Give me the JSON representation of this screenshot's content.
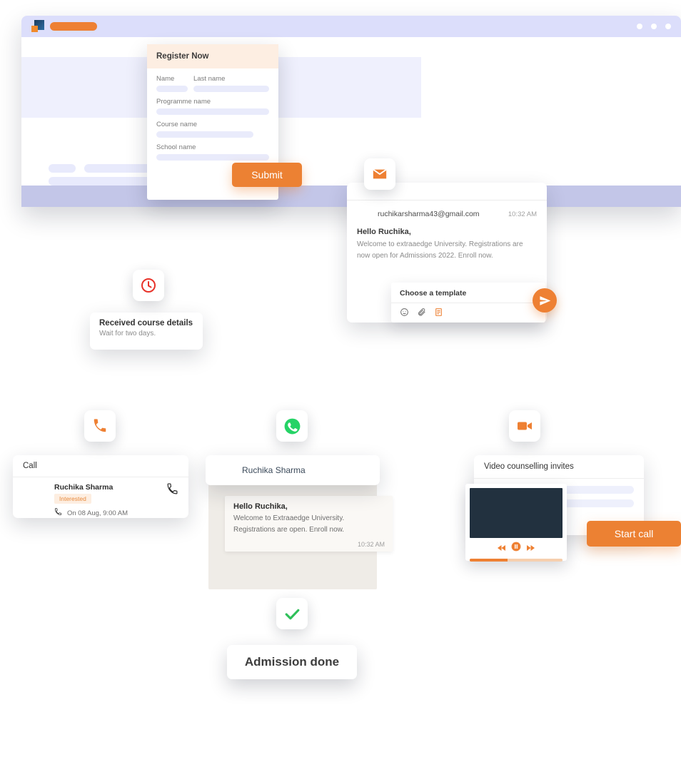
{
  "browser": {
    "logo_icon": "brand-logo-icon",
    "dots": [
      "dot",
      "dot",
      "dot"
    ]
  },
  "register_form": {
    "title": "Register Now",
    "fields": [
      {
        "label": "Name"
      },
      {
        "label": "Last name"
      },
      {
        "label": "Programme name"
      },
      {
        "label": "Course name"
      },
      {
        "label": "School name"
      }
    ],
    "submit_label": "Submit"
  },
  "email_card": {
    "node_icon": "envelope-icon",
    "sender": "ruchikarsharma43@gmail.com",
    "time": "10:32 AM",
    "greeting": "Hello Ruchika,",
    "body": "Welcome to extraaedge University. Registrations are now open for Admissions 2022. Enroll now.",
    "template_label": "Choose a template",
    "toolbar_icons": [
      "emoji-icon",
      "attachment-icon",
      "document-icon"
    ],
    "send_icon": "send-icon"
  },
  "course_card": {
    "node_icon": "clock-icon",
    "title": "Received course details",
    "subtitle": "Wait for two days."
  },
  "call_card": {
    "node_icon": "phone-icon",
    "header": "Call",
    "contact_name": "Ruchika Sharma",
    "status_badge": "Interested",
    "schedule": "On 08 Aug, 9:00 AM",
    "call_action_icon": "phone-outline-icon",
    "schedule_icon": "phone-small-icon"
  },
  "whatsapp_card": {
    "node_icon": "whatsapp-icon",
    "contact_name": "Ruchika Sharma",
    "greeting": "Hello Ruchika,",
    "message": "Welcome to Extraaedge University. Registrations are  open. Enroll now.",
    "time": "10:32 AM"
  },
  "video_card": {
    "node_icon": "video-camera-icon",
    "title": "Video counselling invites",
    "player_controls": [
      "rewind-icon",
      "pause-icon",
      "forward-icon"
    ],
    "progress_percent": 41,
    "start_call_label": "Start call"
  },
  "admission_card": {
    "node_icon": "check-icon",
    "title": "Admission done"
  },
  "colors": {
    "accent_orange": "#ec8133",
    "chrome_lavender": "#dcdefb",
    "skeleton": "#eff0fd",
    "clock_red": "#e8332a",
    "whatsapp_green": "#25d366",
    "check_green": "#2fc05a",
    "badge_bg": "#fdeee1",
    "badge_text": "#e88a3d"
  }
}
